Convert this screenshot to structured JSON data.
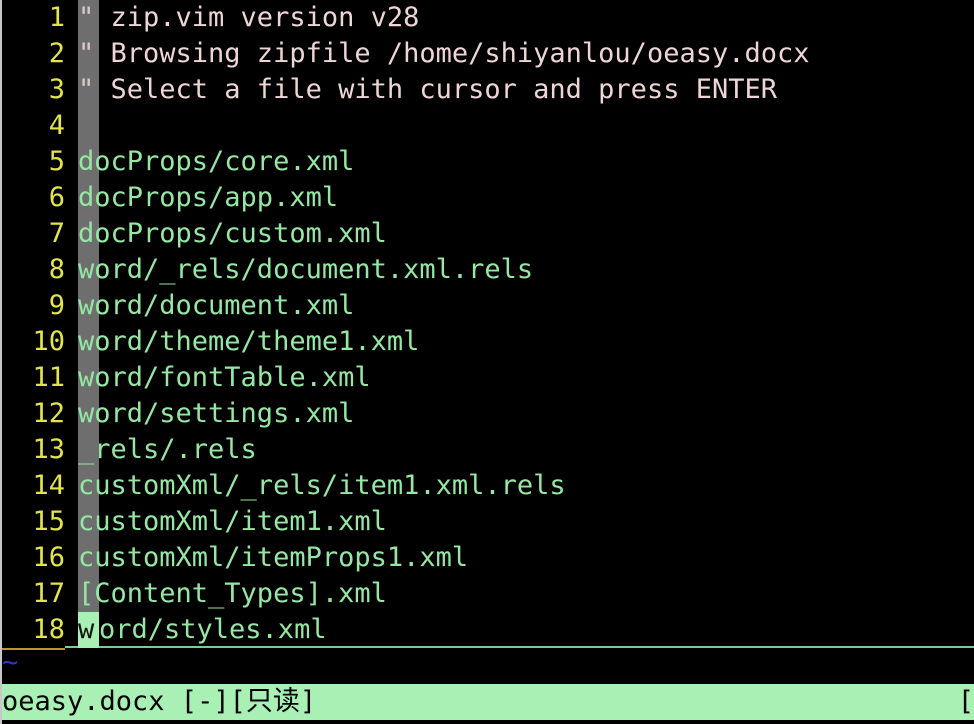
{
  "terminal": {
    "background": "#000000",
    "line_height_px": 36
  },
  "editor": {
    "name": "vim",
    "plugin": "zip.vim",
    "colors": {
      "line_number": "#e3e34b",
      "comment_text": "#eed6d6",
      "comment_marker": "#e0c9c9",
      "filename": "#96e6a4",
      "gutter_bar": "#6e6e6e",
      "cursor_block": "#a8f0b4",
      "cursorline_rule": "#7ecb8c",
      "cursorline_number_rule": "#b8962e",
      "filler_tilde": "#3232cd",
      "statusline_bg": "#a8f0b4",
      "statusline_fg": "#000000"
    },
    "lines": [
      {
        "number": "1",
        "marker": "\"",
        "text": "  zip.vim version v28",
        "kind": "comment"
      },
      {
        "number": "2",
        "marker": "\"",
        "text": "  Browsing zipfile /home/shiyanlou/oeasy.docx",
        "kind": "comment"
      },
      {
        "number": "3",
        "marker": "\"",
        "text": "  Select a file with cursor and press ENTER",
        "kind": "comment"
      },
      {
        "number": "4",
        "marker": "",
        "text": "",
        "kind": "blank"
      },
      {
        "number": "5",
        "marker": "",
        "text": "docProps/core.xml",
        "kind": "filename"
      },
      {
        "number": "6",
        "marker": "",
        "text": "docProps/app.xml",
        "kind": "filename"
      },
      {
        "number": "7",
        "marker": "",
        "text": "docProps/custom.xml",
        "kind": "filename"
      },
      {
        "number": "8",
        "marker": "",
        "text": "word/_rels/document.xml.rels",
        "kind": "filename"
      },
      {
        "number": "9",
        "marker": "",
        "text": "word/document.xml",
        "kind": "filename"
      },
      {
        "number": "10",
        "marker": "",
        "text": "word/theme/theme1.xml",
        "kind": "filename"
      },
      {
        "number": "11",
        "marker": "",
        "text": "word/fontTable.xml",
        "kind": "filename"
      },
      {
        "number": "12",
        "marker": "",
        "text": "word/settings.xml",
        "kind": "filename"
      },
      {
        "number": "13",
        "marker": "",
        "text": "_rels/.rels",
        "kind": "filename"
      },
      {
        "number": "14",
        "marker": "",
        "text": "customXml/_rels/item1.xml.rels",
        "kind": "filename"
      },
      {
        "number": "15",
        "marker": "",
        "text": "customXml/item1.xml",
        "kind": "filename"
      },
      {
        "number": "16",
        "marker": "",
        "text": "customXml/itemProps1.xml",
        "kind": "filename"
      },
      {
        "number": "17",
        "marker": "",
        "text": "[Content_Types].xml",
        "kind": "filename"
      }
    ],
    "cursor_line": {
      "number": "18",
      "cursor_char": "w",
      "rest": "ord/styles.xml",
      "full_text": "word/styles.xml",
      "kind": "filename"
    },
    "filler_lines": [
      {
        "glyph": "~"
      }
    ]
  },
  "statusline": {
    "left": "oeasy.docx [-][只读]",
    "filename": "oeasy.docx",
    "modified_flag": "[-]",
    "readonly_flag": "[只读]",
    "right": "["
  }
}
